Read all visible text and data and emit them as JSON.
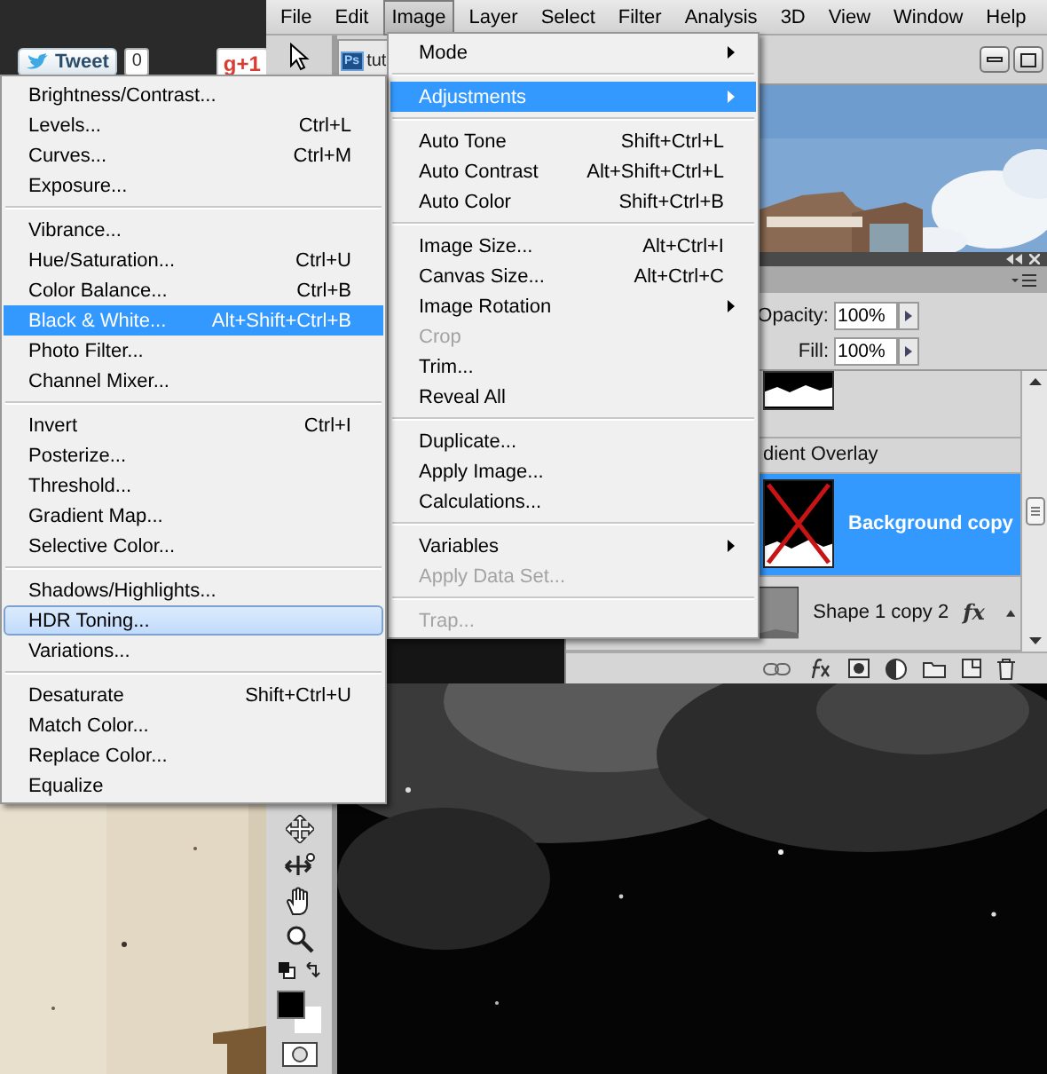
{
  "web_page": {
    "tweet_button": {
      "label": "Tweet",
      "count": "0"
    },
    "plus_button": {
      "label": "g+1"
    }
  },
  "menu_bar": [
    {
      "label": "File",
      "selected": false
    },
    {
      "label": "Edit",
      "selected": false
    },
    {
      "label": "Image",
      "selected": true
    },
    {
      "label": "Layer",
      "selected": false
    },
    {
      "label": "Select",
      "selected": false
    },
    {
      "label": "Filter",
      "selected": false
    },
    {
      "label": "Analysis",
      "selected": false
    },
    {
      "label": "3D",
      "selected": false
    },
    {
      "label": "View",
      "selected": false
    },
    {
      "label": "Window",
      "selected": false
    },
    {
      "label": "Help",
      "selected": false
    }
  ],
  "document": {
    "badge": "Ps",
    "title": "tut"
  },
  "layers_panel": {
    "opacity_label": "Opacity:",
    "opacity": "100%",
    "fill_label": "Fill:",
    "fill": "100%",
    "layers": [
      {
        "kind": "partial",
        "selected": false
      },
      {
        "kind": "effect",
        "label": "dient Overlay"
      },
      {
        "kind": "masked_layer",
        "name": "Background copy",
        "selected": true
      },
      {
        "kind": "shape_layer",
        "name": "Shape 1 copy 2",
        "selected": false,
        "fx": "fx"
      }
    ]
  },
  "image_menu": [
    {
      "kind": "item",
      "label": "Mode",
      "submenu": true,
      "selected": false,
      "disabled": false
    },
    {
      "kind": "separator"
    },
    {
      "kind": "item",
      "label": "Adjustments",
      "submenu": true,
      "selected": true,
      "disabled": false
    },
    {
      "kind": "separator"
    },
    {
      "kind": "item",
      "label": "Auto Tone",
      "shortcut": "Shift+Ctrl+L",
      "selected": false,
      "disabled": false
    },
    {
      "kind": "item",
      "label": "Auto Contrast",
      "shortcut": "Alt+Shift+Ctrl+L",
      "selected": false,
      "disabled": false
    },
    {
      "kind": "item",
      "label": "Auto Color",
      "shortcut": "Shift+Ctrl+B",
      "selected": false,
      "disabled": false
    },
    {
      "kind": "separator"
    },
    {
      "kind": "item",
      "label": "Image Size...",
      "shortcut": "Alt+Ctrl+I",
      "selected": false,
      "disabled": false
    },
    {
      "kind": "item",
      "label": "Canvas Size...",
      "shortcut": "Alt+Ctrl+C",
      "selected": false,
      "disabled": false
    },
    {
      "kind": "item",
      "label": "Image Rotation",
      "submenu": true,
      "selected": false,
      "disabled": false
    },
    {
      "kind": "item",
      "label": "Crop",
      "selected": false,
      "disabled": true
    },
    {
      "kind": "item",
      "label": "Trim...",
      "selected": false,
      "disabled": false
    },
    {
      "kind": "item",
      "label": "Reveal All",
      "selected": false,
      "disabled": false
    },
    {
      "kind": "separator"
    },
    {
      "kind": "item",
      "label": "Duplicate...",
      "selected": false,
      "disabled": false
    },
    {
      "kind": "item",
      "label": "Apply Image...",
      "selected": false,
      "disabled": false
    },
    {
      "kind": "item",
      "label": "Calculations...",
      "selected": false,
      "disabled": false
    },
    {
      "kind": "separator"
    },
    {
      "kind": "item",
      "label": "Variables",
      "submenu": true,
      "selected": false,
      "disabled": false
    },
    {
      "kind": "item",
      "label": "Apply Data Set...",
      "selected": false,
      "disabled": true
    },
    {
      "kind": "separator"
    },
    {
      "kind": "item",
      "label": "Trap...",
      "selected": false,
      "disabled": true
    }
  ],
  "adjustments_menu": [
    {
      "kind": "item",
      "label": "Brightness/Contrast...",
      "selected": false,
      "hovered": false
    },
    {
      "kind": "item",
      "label": "Levels...",
      "shortcut": "Ctrl+L",
      "selected": false,
      "hovered": false
    },
    {
      "kind": "item",
      "label": "Curves...",
      "shortcut": "Ctrl+M",
      "selected": false,
      "hovered": false
    },
    {
      "kind": "item",
      "label": "Exposure...",
      "selected": false,
      "hovered": false
    },
    {
      "kind": "separator"
    },
    {
      "kind": "item",
      "label": "Vibrance...",
      "selected": false,
      "hovered": false
    },
    {
      "kind": "item",
      "label": "Hue/Saturation...",
      "shortcut": "Ctrl+U",
      "selected": false,
      "hovered": false
    },
    {
      "kind": "item",
      "label": "Color Balance...",
      "shortcut": "Ctrl+B",
      "selected": false,
      "hovered": false
    },
    {
      "kind": "item",
      "label": "Black & White...",
      "shortcut": "Alt+Shift+Ctrl+B",
      "selected": true,
      "hovered": false
    },
    {
      "kind": "item",
      "label": "Photo Filter...",
      "selected": false,
      "hovered": false
    },
    {
      "kind": "item",
      "label": "Channel Mixer...",
      "selected": false,
      "hovered": false
    },
    {
      "kind": "separator"
    },
    {
      "kind": "item",
      "label": "Invert",
      "shortcut": "Ctrl+I",
      "selected": false,
      "hovered": false
    },
    {
      "kind": "item",
      "label": "Posterize...",
      "selected": false,
      "hovered": false
    },
    {
      "kind": "item",
      "label": "Threshold...",
      "selected": false,
      "hovered": false
    },
    {
      "kind": "item",
      "label": "Gradient Map...",
      "selected": false,
      "hovered": false
    },
    {
      "kind": "item",
      "label": "Selective Color...",
      "selected": false,
      "hovered": false
    },
    {
      "kind": "separator"
    },
    {
      "kind": "item",
      "label": "Shadows/Highlights...",
      "selected": false,
      "hovered": false
    },
    {
      "kind": "item",
      "label": "HDR Toning...",
      "selected": false,
      "hovered": true
    },
    {
      "kind": "item",
      "label": "Variations...",
      "selected": false,
      "hovered": false
    },
    {
      "kind": "separator"
    },
    {
      "kind": "item",
      "label": "Desaturate",
      "shortcut": "Shift+Ctrl+U",
      "selected": false,
      "hovered": false
    },
    {
      "kind": "item",
      "label": "Match Color...",
      "selected": false,
      "hovered": false
    },
    {
      "kind": "item",
      "label": "Replace Color...",
      "selected": false,
      "hovered": false
    },
    {
      "kind": "item",
      "label": "Equalize",
      "selected": false,
      "hovered": false
    }
  ]
}
